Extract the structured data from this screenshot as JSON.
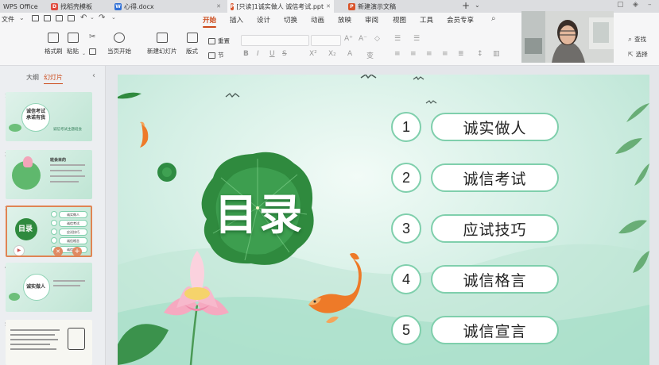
{
  "tabs": [
    {
      "label": "WPS Office",
      "icon": "wps-logo-icon"
    },
    {
      "label": "找稻壳模板",
      "icon": "docer-icon"
    },
    {
      "label": "心得.docx",
      "icon": "word-doc-icon"
    },
    {
      "label": "[只读]1诚实做人 诚信考试.ppt",
      "icon": "ppt-icon",
      "active": true
    },
    {
      "label": "新建演示文稿",
      "icon": "ppt-icon"
    }
  ],
  "file_menu": "文件",
  "menu": [
    "开始",
    "插入",
    "设计",
    "切换",
    "动画",
    "放映",
    "审阅",
    "视图",
    "工具",
    "会员专享"
  ],
  "active_menu": "开始",
  "ribbon": {
    "format_painter": "格式刷",
    "paste": "粘贴",
    "start_from_current": "当页开始",
    "new_slide": "新建幻灯片",
    "layout": "版式",
    "reset": "重置",
    "section": "节",
    "find": "查找",
    "select": "选择",
    "format_letters": [
      "B",
      "I",
      "U",
      "S",
      "X²",
      "X₂",
      "A",
      "变"
    ]
  },
  "panel_tabs": {
    "outline": "大纲",
    "slides": "幻灯片"
  },
  "thumbnails": [
    {
      "num": "1",
      "title": "诚信考试 承诺有我",
      "subtitle": "诚信考试主题班会"
    },
    {
      "num": "2",
      "title": "班会目的"
    },
    {
      "num": "3",
      "title": "目录",
      "items": [
        "诚实做人",
        "诚信考试",
        "应试技巧",
        "诚信格言",
        "诚信宣言"
      ],
      "selected": true
    },
    {
      "num": "4",
      "title": "诚实做人"
    },
    {
      "num": "5",
      "title": ""
    }
  ],
  "slide": {
    "title": "目录",
    "items": [
      {
        "num": "1",
        "label": "诚实做人"
      },
      {
        "num": "2",
        "label": "诚信考试"
      },
      {
        "num": "3",
        "label": "应试技巧"
      },
      {
        "num": "4",
        "label": "诚信格言"
      },
      {
        "num": "5",
        "label": "诚信宣言"
      }
    ]
  },
  "colors": {
    "accent": "#cc4a1a",
    "slide_green": "#7fcfac",
    "leaf_green": "#2f8a3e"
  }
}
